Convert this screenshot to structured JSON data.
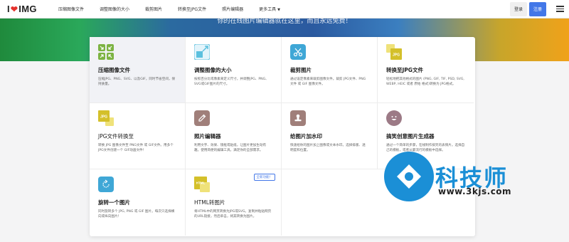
{
  "logo": {
    "left": "I",
    "right": "IMG"
  },
  "nav": [
    {
      "label": "压缩图像文件"
    },
    {
      "label": "调整图像的大小"
    },
    {
      "label": "裁剪图片"
    },
    {
      "label": "转换至JPG文件"
    },
    {
      "label": "照片编辑器"
    },
    {
      "label": "更多工具"
    }
  ],
  "auth": {
    "login": "登录",
    "signup": "注册"
  },
  "hero": {
    "text": "你的在线图片编辑器就在这里，而且永远免费！"
  },
  "tools": [
    {
      "title": "压缩图像文件",
      "desc": "压缩JPG、PNG、SVG、以及GIF，同时节省空间，保持质量。",
      "icon": "compress-icon",
      "color": "#7cb342"
    },
    {
      "title": "调整图像的大小",
      "desc": "按照百分比或像素来定义尺寸，并调整JPG、PNG、SVG或GIF图片的尺寸。",
      "icon": "resize-icon",
      "color": "#5bc0de"
    },
    {
      "title": "裁剪图片",
      "desc": "通过设定像素来裁剪图像文件。裁剪 JPG文件、PNG文件 或 GIF 图像文件。",
      "icon": "crop-icon",
      "color": "#3fa7d6"
    },
    {
      "title": "转换至JPG文件",
      "desc": "轻松地把其他格式的图片 (PNG, GIF, TIF, PSD, SVG, WEBP, HEIC 或者 原始 格式)转换为 JPG格式。",
      "icon": "to-jpg-icon",
      "color": "#d4c02a"
    },
    {
      "title": "JPG文件转换至",
      "desc": "转换 JPG 图像文件至 PNG文件 或 GIF文件。用多个JPG文件创建一个 GIF动画文件！",
      "icon": "from-jpg-icon",
      "color": "#d4c02a"
    },
    {
      "title": "照片编辑器",
      "desc": "利用文字、效果、镜框或贴纸，让图片更加生动有趣。使用简便的编辑工具，满足你的全部需求。",
      "icon": "photo-editor-icon",
      "color": "#a07f7a"
    },
    {
      "title": "给图片加水印",
      "desc": "快速给你的图片加上图像或文本水印。选择排版、透明度和位置。",
      "icon": "watermark-icon",
      "color": "#a07f7a"
    },
    {
      "title": "搞笑创意图片生成器",
      "desc": "通过一个简单的步骤，在线制作搞笑的表情片。选择自己的模板，或者从最流行的模板中选择。",
      "icon": "meme-icon",
      "color": "#9c7a86"
    },
    {
      "title": "旋转一个图片",
      "desc": "同时旋转多个 JPG, PNG 或 GIF 图片。每次只选择横向或纵向图片！",
      "icon": "rotate-icon",
      "color": "#3fa7d6"
    },
    {
      "title": "HTML转图片",
      "desc": "将HTML中的网页转换为JPG或SVG。复制并粘贴网页的URL链接，然后单击，将其转换为图片。",
      "icon": "html-to-image-icon",
      "color": "#d4c02a",
      "badge": "全新功能！"
    }
  ],
  "watermark": {
    "brand": "科技师",
    "url": "www.3kjs.com"
  }
}
